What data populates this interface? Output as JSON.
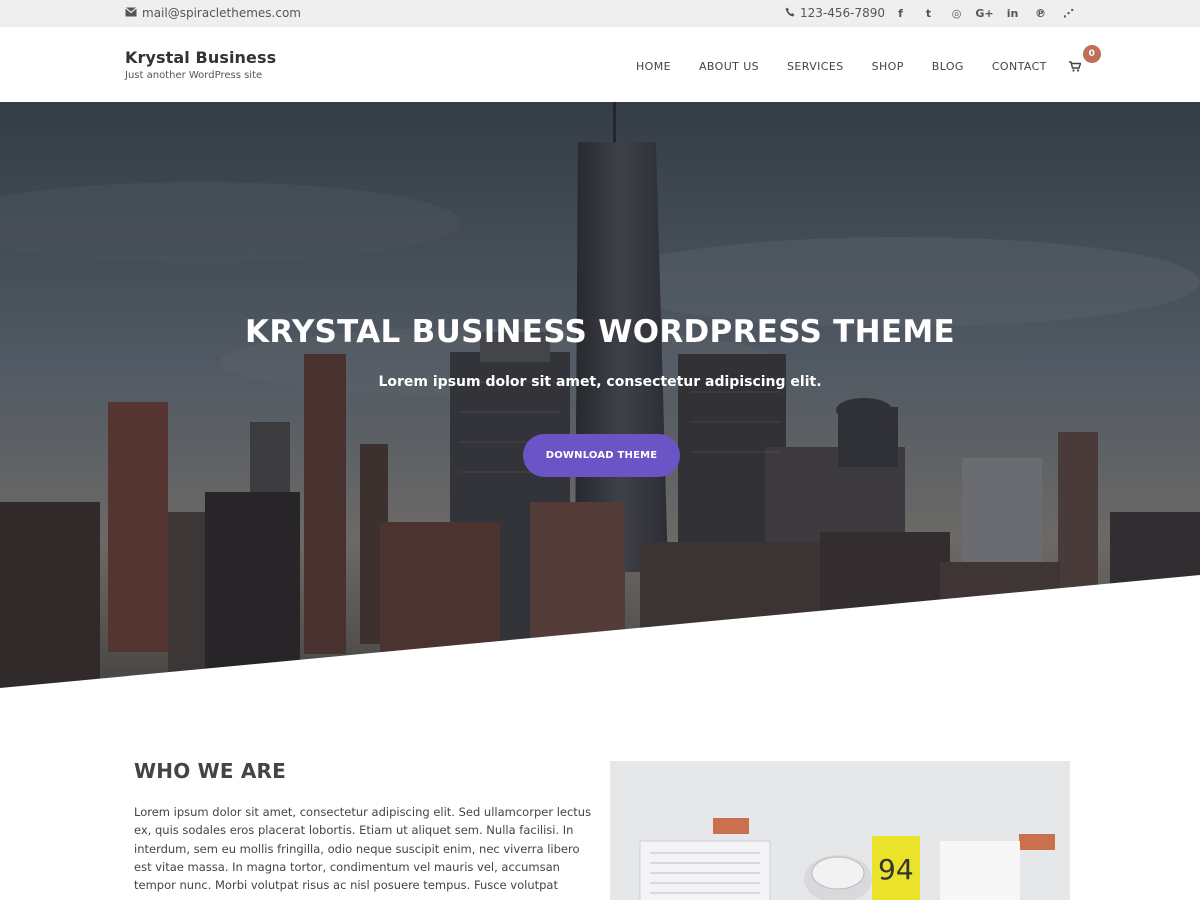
{
  "topbar": {
    "email": "mail@spiraclethemes.com",
    "phone": "123-456-7890",
    "social": [
      {
        "icon": "facebook-icon",
        "glyph": "f"
      },
      {
        "icon": "twitter-icon",
        "glyph": "t"
      },
      {
        "icon": "instagram-icon",
        "glyph": "◎"
      },
      {
        "icon": "google-plus-icon",
        "glyph": "G+"
      },
      {
        "icon": "linkedin-icon",
        "glyph": "in"
      },
      {
        "icon": "pinterest-icon",
        "glyph": "℗"
      },
      {
        "icon": "rss-icon",
        "glyph": "⋰"
      }
    ]
  },
  "brand": {
    "title": "Krystal Business",
    "tagline": "Just another WordPress site"
  },
  "nav": {
    "items": [
      "HOME",
      "ABOUT US",
      "SERVICES",
      "SHOP",
      "BLOG",
      "CONTACT"
    ],
    "cart_count": "0"
  },
  "hero": {
    "headline": "KRYSTAL BUSINESS WORDPRESS THEME",
    "subtitle": "Lorem ipsum dolor sit amet, consectetur adipiscing elit.",
    "cta": "DOWNLOAD THEME"
  },
  "who": {
    "title": "WHO WE ARE",
    "text": "Lorem ipsum dolor sit amet, consectetur adipiscing elit. Sed ullamcorper lectus ex, quis sodales eros placerat lobortis. Etiam ut aliquet sem. Nulla facilisi. In interdum, sem eu mollis fringilla, odio neque suscipit enim, nec viverra libero est vitae massa. In magna tortor, condimentum vel mauris vel, accumsan tempor nunc. Morbi volutpat risus ac nisl posuere tempus. Fusce volutpat"
  },
  "colors": {
    "accent": "#6b55c6",
    "cart_badge": "#c07058",
    "topbar_bg": "#efefef"
  }
}
